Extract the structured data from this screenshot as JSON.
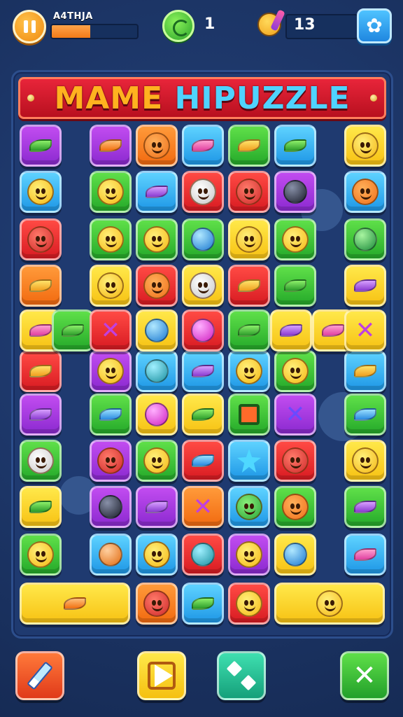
{
  "hud": {
    "level_label": "A4THJA",
    "progress_fraction": 0.45,
    "coins": "1",
    "moves": "13"
  },
  "banner": {
    "title_part1": "MAME",
    "title_part2": "HIPUZZLE"
  },
  "tiles": [
    {
      "c": "purple",
      "ic": "leaf-green"
    },
    {
      "c": "purple",
      "ic": "leaf-orange"
    },
    {
      "c": "orange",
      "ic": "face-orange"
    },
    {
      "c": "blue",
      "ic": "leaf-pink"
    },
    {
      "c": "green",
      "ic": "leaf-yellow"
    },
    {
      "c": "blue",
      "ic": "leaf-green"
    },
    {
      "c": "yellow",
      "ic": "face-yellow"
    },
    {
      "c": "blue",
      "ic": "face-yellow"
    },
    {
      "c": "green",
      "ic": "face-yellow"
    },
    {
      "c": "blue",
      "ic": "leaf-purple"
    },
    {
      "c": "red",
      "ic": "face-white"
    },
    {
      "c": "red",
      "ic": "face-red"
    },
    {
      "c": "purple",
      "ic": "orb-dark"
    },
    {
      "c": "blue",
      "ic": "face-orange"
    },
    {
      "c": "red",
      "ic": "face-red"
    },
    {
      "c": "green",
      "ic": "face-yellow"
    },
    {
      "c": "green",
      "ic": "face-yellow"
    },
    {
      "c": "green",
      "ic": "orb-blue"
    },
    {
      "c": "yellow",
      "ic": "face-yellow"
    },
    {
      "c": "green",
      "ic": "face-yellow"
    },
    {
      "c": "green",
      "ic": "orb-green"
    },
    {
      "c": "orange",
      "ic": "leaf-yellow"
    },
    {
      "c": "yellow",
      "ic": "face-yellow"
    },
    {
      "c": "red",
      "ic": "face-orange"
    },
    {
      "c": "yellow",
      "ic": "face-white"
    },
    {
      "c": "red",
      "ic": "leaf-yellow"
    },
    {
      "c": "green",
      "ic": "leaf-green"
    },
    {
      "c": "yellow",
      "ic": "leaf-purple"
    },
    {
      "c": "red",
      "ic": "leaf-yellow"
    },
    {
      "c": "purple",
      "ic": "face-yellow"
    },
    {
      "c": "blue",
      "ic": "orb-teal"
    },
    {
      "c": "blue",
      "ic": "leaf-purple"
    },
    {
      "c": "blue",
      "ic": "face-yellow"
    },
    {
      "c": "green",
      "ic": "face-yellow"
    },
    {
      "c": "blue",
      "ic": "leaf-yellow"
    },
    {
      "c": "purple",
      "ic": "leaf-purple"
    },
    {
      "c": "green",
      "ic": "leaf-blue"
    },
    {
      "c": "yellow",
      "ic": "orb-pink"
    },
    {
      "c": "yellow",
      "ic": "leaf-green"
    },
    {
      "c": "green",
      "ic": "box"
    },
    {
      "c": "purple",
      "ic": "cross-blue"
    },
    {
      "c": "green",
      "ic": "leaf-blue"
    },
    {
      "c": "green",
      "ic": "face-white"
    },
    {
      "c": "purple",
      "ic": "face-red"
    },
    {
      "c": "green",
      "ic": "face-yellow"
    },
    {
      "c": "red",
      "ic": "leaf-blue"
    },
    {
      "c": "blue",
      "ic": "star"
    },
    {
      "c": "red",
      "ic": "face-red"
    },
    {
      "c": "yellow",
      "ic": "face-yellow"
    },
    {
      "c": "yellow",
      "ic": "leaf-green"
    },
    {
      "c": "purple",
      "ic": "orb-dark"
    },
    {
      "c": "purple",
      "ic": "leaf-purple"
    },
    {
      "c": "orange",
      "ic": "cross-purple"
    },
    {
      "c": "blue",
      "ic": "face-green"
    },
    {
      "c": "green",
      "ic": "face-orange"
    },
    {
      "c": "green",
      "ic": "leaf-purple"
    },
    {
      "c": "green",
      "ic": "face-yellow"
    },
    {
      "c": "blue",
      "ic": "orb-orange"
    },
    {
      "c": "blue",
      "ic": "face-yellow"
    },
    {
      "c": "red",
      "ic": "orb-teal"
    },
    {
      "c": "purple",
      "ic": "face-yellow"
    },
    {
      "c": "yellow",
      "ic": "orb-blue"
    },
    {
      "c": "blue",
      "ic": "leaf-pink"
    }
  ],
  "row5": [
    {
      "c": "yellow",
      "ic": "leaf-pink"
    },
    {
      "c": "green",
      "ic": "leaf-green"
    },
    {
      "c": "red",
      "ic": "cross-purple"
    },
    {
      "c": "yellow",
      "ic": "orb-blue"
    },
    {
      "c": "red",
      "ic": "orb-pink"
    },
    {
      "c": "green",
      "ic": "leaf-green"
    },
    {
      "c": "yellow",
      "ic": "leaf-purple"
    },
    {
      "c": "yellow",
      "ic": "leaf-pink"
    },
    {
      "c": "yellow",
      "ic": "cross-purple"
    }
  ],
  "bottom_row": [
    {
      "c": "yellow",
      "ic": "leaf-orange"
    },
    {
      "c": "orange",
      "ic": "face-red"
    },
    {
      "c": "blue",
      "ic": "leaf-green"
    },
    {
      "c": "red",
      "ic": "face-yellow"
    },
    {
      "c": "yellow",
      "ic": "face-yellow"
    }
  ],
  "controls": {
    "hint_icon": "pencil-icon",
    "play_icon": "play-icon",
    "shuffle_icon": "dice-icon",
    "close_icon": "close-icon",
    "close_glyph": "✕",
    "settings_glyph": "✿"
  },
  "colors": {
    "background": "#1c3566",
    "banner": "#d8182c",
    "pause": "#f5a020",
    "settings": "#2a9cf0"
  }
}
